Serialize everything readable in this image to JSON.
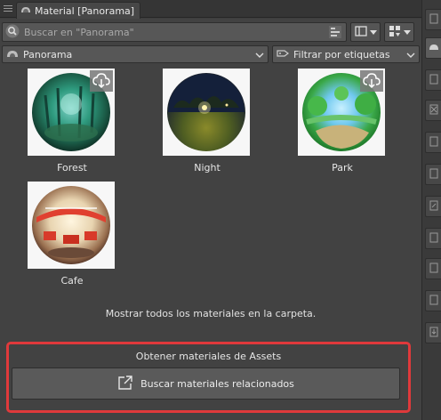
{
  "tab": {
    "title": "Material [Panorama]"
  },
  "search": {
    "placeholder": "Buscar en \"Panorama\""
  },
  "folder_select": {
    "value": "Panorama"
  },
  "tag_filter": {
    "value": "Filtrar por etiquetas"
  },
  "materials": [
    {
      "name": "Forest",
      "downloadable": true
    },
    {
      "name": "Night",
      "downloadable": false
    },
    {
      "name": "Park",
      "downloadable": true
    },
    {
      "name": "Cafe",
      "downloadable": false
    }
  ],
  "show_all": "Mostrar todos los materiales en la carpeta.",
  "assets": {
    "title": "Obtener materiales de Assets",
    "button": "Buscar materiales relacionados"
  },
  "colors": {
    "highlight": "#e0393b",
    "panel_bg": "#424242"
  }
}
